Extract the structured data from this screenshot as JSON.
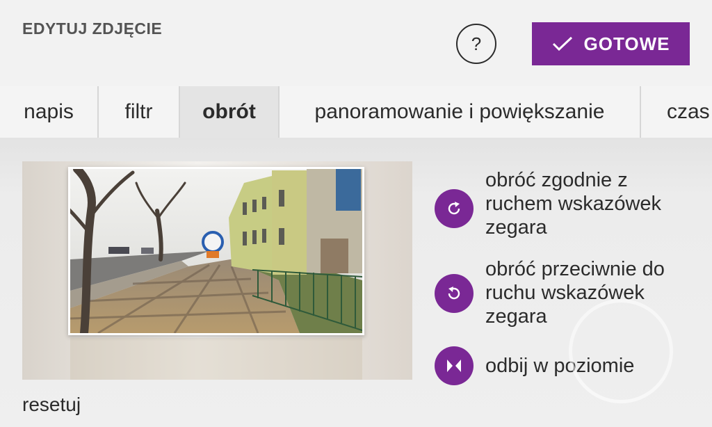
{
  "header": {
    "title": "EDYTUJ ZDJĘCIE",
    "help_label": "?",
    "done_label": "GOTOWE"
  },
  "tabs": [
    {
      "label": "napis",
      "active": false
    },
    {
      "label": "filtr",
      "active": false
    },
    {
      "label": "obrót",
      "active": true
    },
    {
      "label": "panoramowanie i powiększanie",
      "active": false
    },
    {
      "label": "czas",
      "active": false
    }
  ],
  "actions": [
    {
      "label": "obróć zgodnie z ruchem wskazówek zegara",
      "icon": "rotate-clockwise-icon"
    },
    {
      "label": "obróć przeciwnie do ruchu wskazówek zegara",
      "icon": "rotate-counterclockwise-icon"
    },
    {
      "label": "odbij w poziomie",
      "icon": "flip-horizontal-icon"
    }
  ],
  "footer": {
    "reset_label": "resetuj"
  },
  "colors": {
    "accent": "#7a2895",
    "background": "#f2f2f2",
    "text": "#2b2b2b"
  }
}
